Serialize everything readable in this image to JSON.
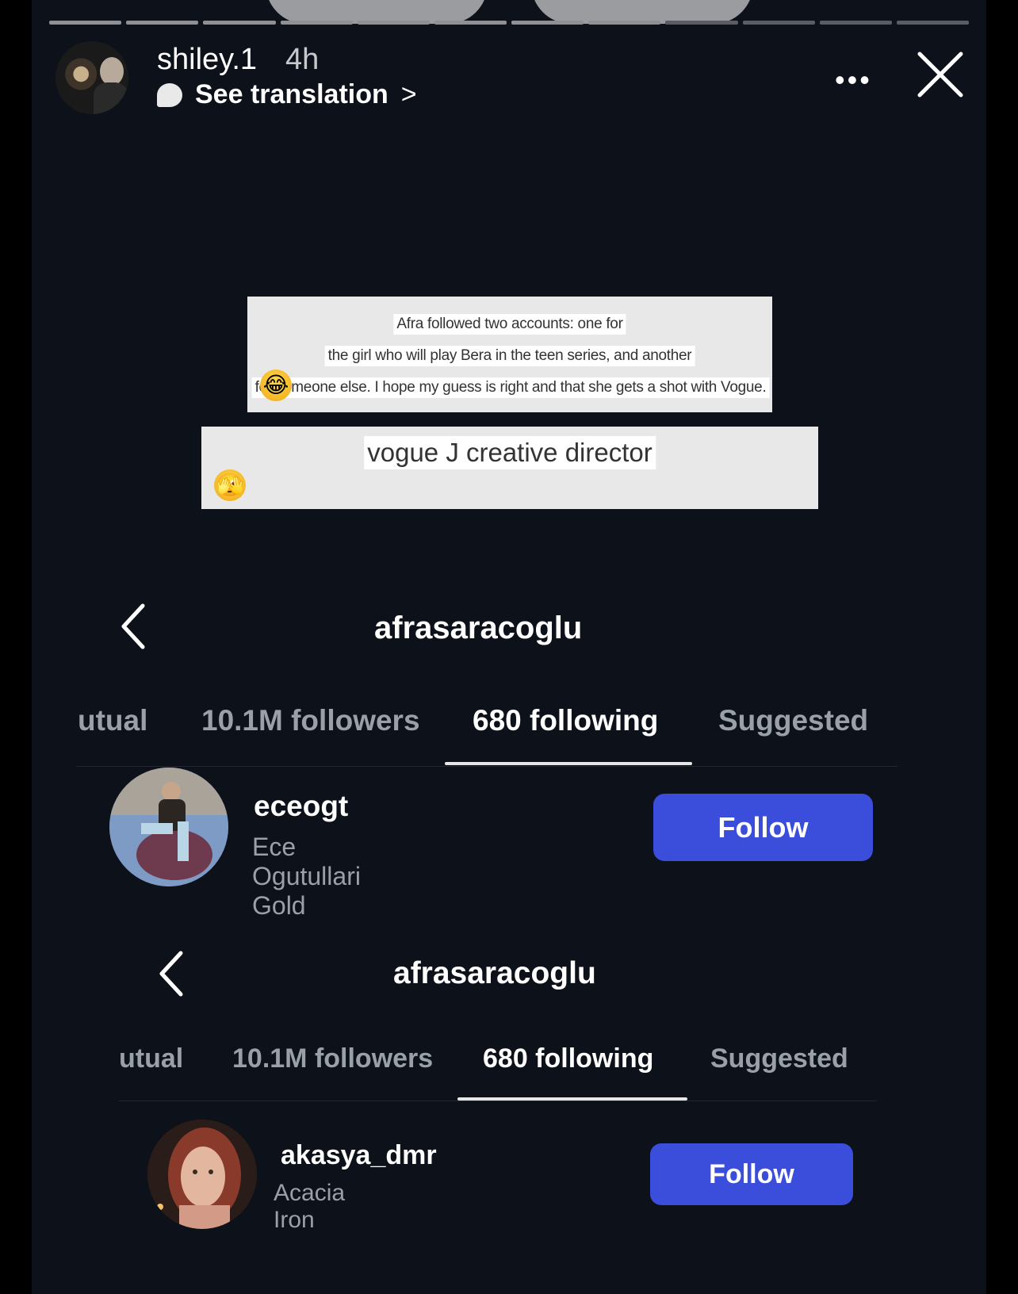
{
  "story": {
    "username": "shiley.1",
    "time": "4h",
    "translate_label": "See translation",
    "translate_chevron": ">",
    "more_icon": "more-icon",
    "close_icon": "close-icon"
  },
  "notes": {
    "note1_lines": [
      "Afra followed two accounts: one for",
      "the girl who will play Bera in the teen series, and another",
      "for someone else. I hope my guess is right and that she gets a shot with Vogue."
    ],
    "note1_emoji": "😂",
    "note2_line": "vogue J creative director",
    "note2_emoji": "🫣"
  },
  "panel1": {
    "title": "afrasaracoglu",
    "tabs": [
      "utual",
      "10.1M followers",
      "680 following",
      "Suggested"
    ],
    "active_tab": 2,
    "row": {
      "username": "eceogt",
      "name": "Ece Ogutullari Gold",
      "button": "Follow"
    }
  },
  "panel2": {
    "title": "afrasaracoglu",
    "tabs": [
      "utual",
      "10.1M followers",
      "680 following",
      "Suggested"
    ],
    "active_tab": 2,
    "row": {
      "username": "akasya_dmr",
      "name": "Acacia Iron",
      "button": "Follow"
    }
  },
  "colors": {
    "background": "#0d111a",
    "follow_button": "#3a4ddb",
    "secondary_text": "#9aa0a8"
  }
}
